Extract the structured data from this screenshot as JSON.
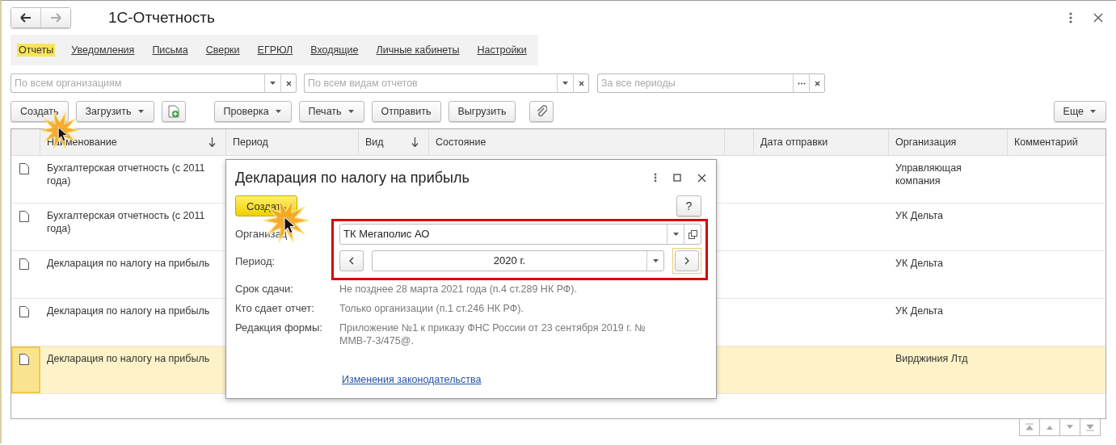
{
  "window": {
    "title": "1С-Отчетность"
  },
  "nav_tabs": [
    {
      "label": "Отчеты",
      "selected": true
    },
    {
      "label": "Уведомления",
      "selected": false
    },
    {
      "label": "Письма",
      "selected": false
    },
    {
      "label": "Сверки",
      "selected": false
    },
    {
      "label": "ЕГРЮЛ",
      "selected": false
    },
    {
      "label": "Входящие",
      "selected": false
    },
    {
      "label": "Личные кабинеты",
      "selected": false
    },
    {
      "label": "Настройки",
      "selected": false
    }
  ],
  "filters": [
    {
      "placeholder": "По всем организациям",
      "kind": "dropdown"
    },
    {
      "placeholder": "По всем видам отчетов",
      "kind": "dropdown"
    },
    {
      "placeholder": "За все периоды",
      "kind": "picker"
    }
  ],
  "toolbar": [
    {
      "kind": "plain",
      "label": "Создать"
    },
    {
      "kind": "menu",
      "label": "Загрузить"
    },
    {
      "kind": "add-file"
    },
    {
      "kind": "menu",
      "label": "Проверка"
    },
    {
      "kind": "menu",
      "label": "Печать"
    },
    {
      "kind": "plain",
      "label": "Отправить"
    },
    {
      "kind": "plain",
      "label": "Выгрузить"
    },
    {
      "kind": "attach"
    }
  ],
  "more_button": "Еще",
  "table": {
    "columns": [
      {
        "kind": "icon"
      },
      {
        "kind": "text",
        "label": "Наименование",
        "sorted": true
      },
      {
        "kind": "text",
        "label": "Период",
        "sorted": false
      },
      {
        "kind": "text",
        "label": "Вид",
        "sorted": true
      },
      {
        "kind": "text",
        "label": "Состояние",
        "sorted": false
      },
      {
        "kind": "blank"
      },
      {
        "kind": "text",
        "label": "Дата отправки",
        "sorted": false
      },
      {
        "kind": "text",
        "label": "Организация",
        "sorted": false
      },
      {
        "kind": "text",
        "label": "Комментарий",
        "sorted": false
      }
    ],
    "rows": [
      {
        "name": "Бухгалтерская отчетность (с 2011 года)",
        "organization": "Управляющая компания",
        "selected": false
      },
      {
        "name": "Бухгалтерская отчетность (с 2011 года)",
        "organization": "УК Дельта",
        "selected": false
      },
      {
        "name": "Декларация по налогу на прибыль",
        "organization": "УК Дельта",
        "selected": false
      },
      {
        "name": "Декларация по налогу на прибыль",
        "organization": "УК Дельта",
        "selected": false
      },
      {
        "name": "Декларация по налогу на прибыль",
        "organization": "Вирджиния Лтд",
        "selected": true
      }
    ]
  },
  "dialog": {
    "title": "Декларация по налогу на прибыль",
    "create_button": "Создать",
    "help_button": "?",
    "fields": [
      {
        "kind": "select",
        "label": "Организац",
        "value": "ТК Мегаполис АО"
      },
      {
        "kind": "period",
        "label": "Период:",
        "value": "2020 г."
      }
    ],
    "info": [
      {
        "label": "Срок сдачи:",
        "value": "Не позднее 28 марта 2021 года (п.4 ст.289 НК РФ)."
      },
      {
        "label": "Кто сдает отчет:",
        "value": "Только организации (п.1 ст.246 НК РФ)."
      },
      {
        "label": "Редакция формы:",
        "value": "Приложение №1 к приказу ФНС России от 23 сентября 2019 г. № ММВ-7-3/475@."
      }
    ],
    "link": "Изменения законодательства"
  }
}
